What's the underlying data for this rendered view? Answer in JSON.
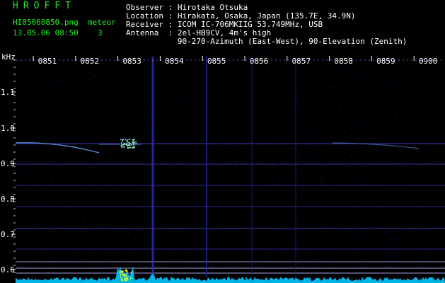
{
  "app": {
    "brand": "HROFFT",
    "filename": "HI05060850.png",
    "timestamp": "13.05.06 08:50",
    "meteor_label": "meteor",
    "meteor_count": "3"
  },
  "info": {
    "observer": "Observer : Hirotaka Otsuka",
    "location": "Location : Hirakata, Osaka, Japan (135.7E, 34.9N)",
    "receiver": "Receiver : ICOM IC-706MKIIG 53.749MHz, USB",
    "antenna": "Antenna  : 2el-HB9CV, 4m's high",
    "antenna2": "           90-270-Azimuth (East-West), 90-Elevation (Zenith)"
  },
  "axes": {
    "y_unit": "kHz",
    "y_ticks": [
      "1.1",
      "1.0",
      "0.9",
      "0.8",
      "0.7",
      "0.6"
    ],
    "x_ticks": [
      "0851",
      "0852",
      "0853",
      "0854",
      "0855",
      "0856",
      "0857",
      "0858",
      "0859",
      "0900"
    ]
  },
  "colors": {
    "background": "#000000",
    "noise": "#1a1aa0",
    "tick_text": "#ffffff",
    "brand": "#22ee22",
    "trace": "#7fd7ff",
    "spectrum": "#00c8ff",
    "peak": "#ffff00"
  }
}
